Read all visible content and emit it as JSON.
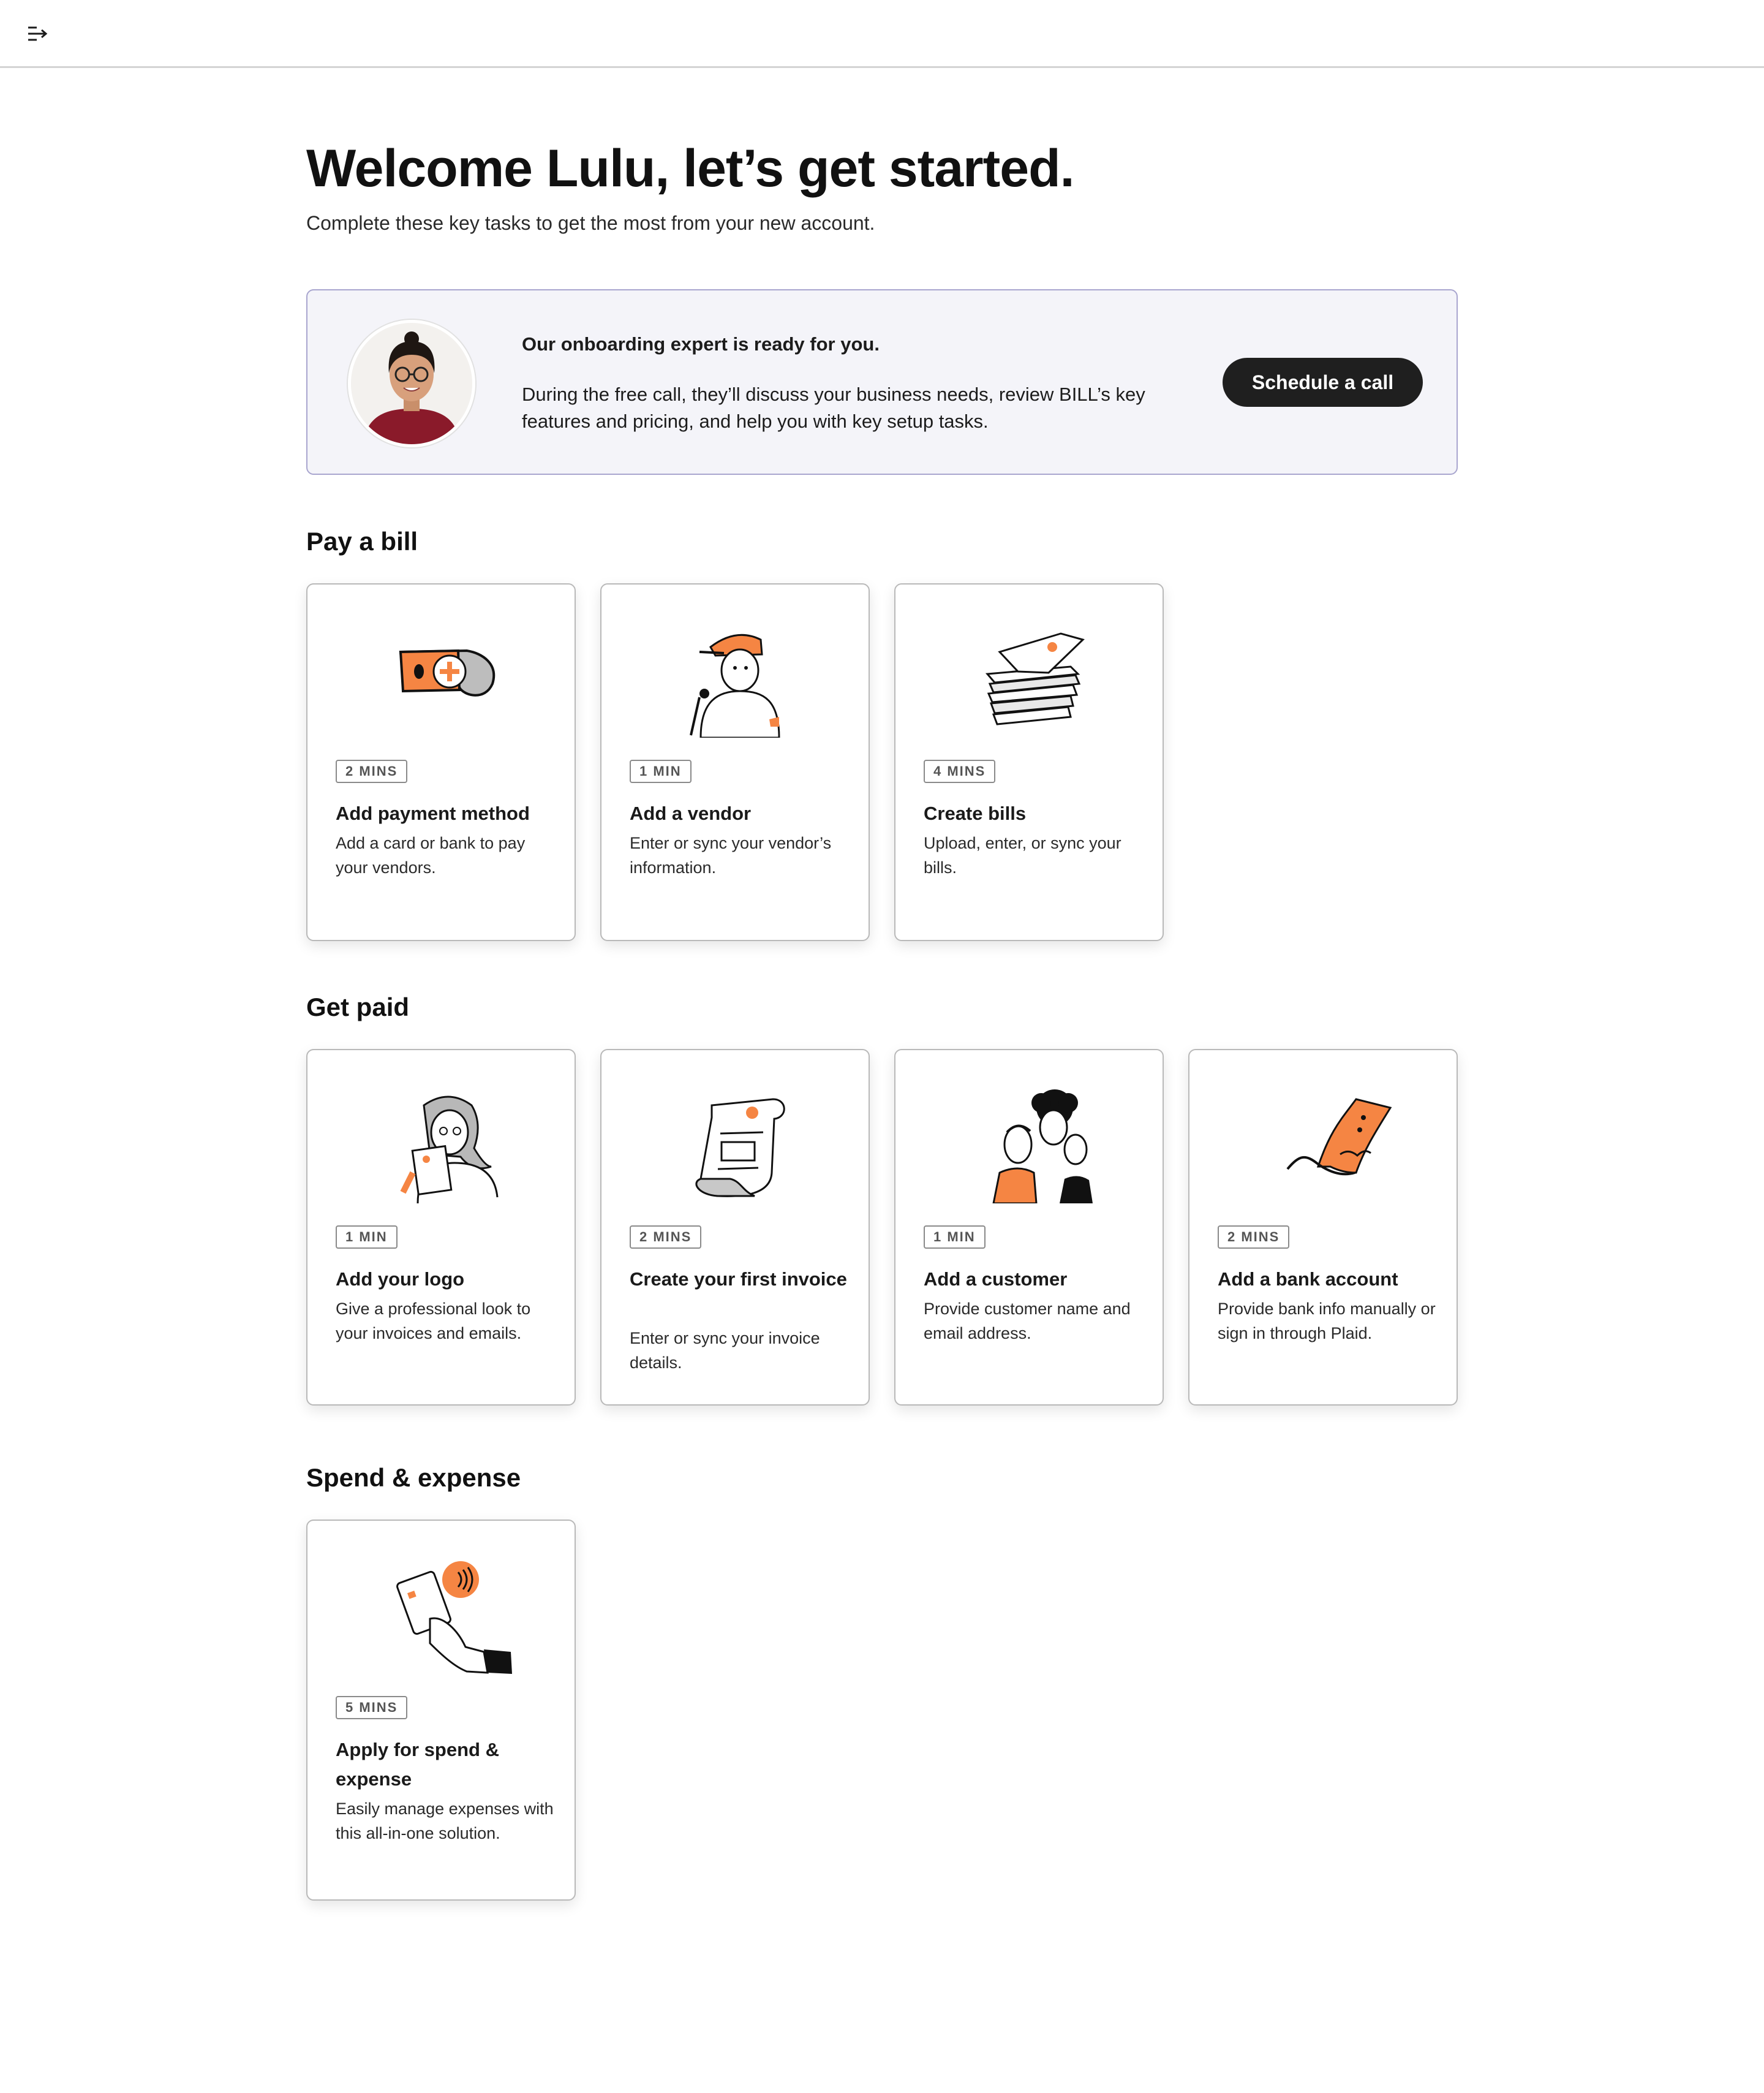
{
  "header": {
    "menu_icon": "expand-menu-icon"
  },
  "main": {
    "title": "Welcome Lulu, let’s get started.",
    "subtitle": "Complete these key tasks to get the most from your new account."
  },
  "expert": {
    "heading": "Our onboarding expert is ready for you.",
    "body": "During the free call, they’ll discuss your business needs, review BILL’s key features and pricing, and help you with key setup tasks.",
    "button_label": "Schedule a call"
  },
  "colors": {
    "accent": "#f58543",
    "dark": "#1f1f1f",
    "expert_bg": "#f4f4f9",
    "expert_border": "#a9a6cf"
  },
  "sections": [
    {
      "title": "Pay a bill",
      "cards": [
        {
          "icon": "money-plus-icon",
          "badge": "2 MINS",
          "title": "Add payment method",
          "desc": "Add a card or bank to pay your vendors."
        },
        {
          "icon": "vendor-person-icon",
          "badge": "1 MIN",
          "title": "Add a vendor",
          "desc": "Enter or sync your vendor’s information."
        },
        {
          "icon": "bills-stack-icon",
          "badge": "4 MINS",
          "title": "Create bills",
          "desc": "Upload, enter, or sync your bills."
        }
      ]
    },
    {
      "title": "Get paid",
      "cards": [
        {
          "icon": "logo-person-icon",
          "badge": "1 MIN",
          "title": "Add your logo",
          "desc": "Give a professional look to your invoices and emails."
        },
        {
          "icon": "invoice-scroll-icon",
          "badge": "2 MINS",
          "title": "Create your first invoice",
          "desc": "Enter or sync your invoice details."
        },
        {
          "icon": "customers-group-icon",
          "badge": "1 MIN",
          "title": "Add a customer",
          "desc": "Provide customer name and email address."
        },
        {
          "icon": "bank-check-icon",
          "badge": "2 MINS",
          "title": "Add a bank account",
          "desc": "Provide bank info manually or sign in through Plaid."
        }
      ]
    },
    {
      "title": "Spend & expense",
      "cards": [
        {
          "icon": "contactless-card-icon",
          "badge": "5 MINS",
          "title": "Apply for spend & expense",
          "desc": "Easily manage expenses with this all-in-one solution."
        }
      ]
    }
  ]
}
